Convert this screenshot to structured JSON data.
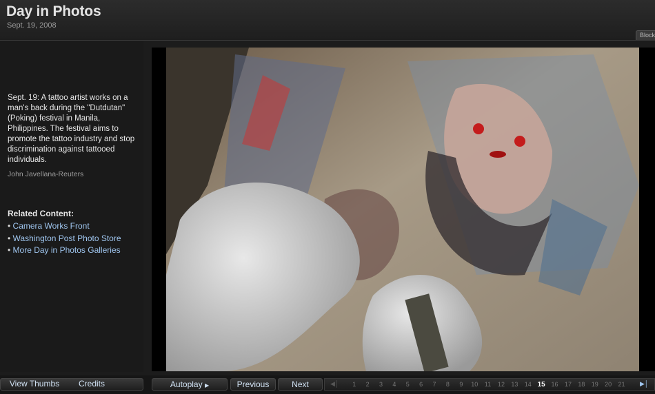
{
  "header": {
    "title": "Day in Photos",
    "date": "Sept. 19, 2008",
    "tab_label": "Block"
  },
  "sidebar": {
    "caption": "Sept. 19: A tattoo artist works on a man's back during the \"Dutdutan\" (Poking) festival in Manila, Philippines. The festival aims to promote the tattoo industry and stop discrimination against tattooed individuals.",
    "credit": "John Javellana-Reuters",
    "related_heading": "Related Content:",
    "related_links": [
      "Camera Works Front",
      "Washington Post Photo Store",
      "More Day in Photos Galleries"
    ]
  },
  "photo": {
    "alt": "Tattoo artist in white gloves tattooing a woman figure on a man's back"
  },
  "toolbar": {
    "view_thumbs": "View Thumbs",
    "credits": "Credits",
    "autoplay": "Autoplay",
    "previous": "Previous",
    "next": "Next"
  },
  "pager": {
    "pages": [
      "1",
      "2",
      "3",
      "4",
      "5",
      "6",
      "7",
      "8",
      "9",
      "10",
      "11",
      "12",
      "13",
      "14",
      "15",
      "16",
      "17",
      "18",
      "19",
      "20",
      "21"
    ],
    "current": "15"
  },
  "colors": {
    "link": "#9fc5ee",
    "background": "#1c1c1c"
  }
}
